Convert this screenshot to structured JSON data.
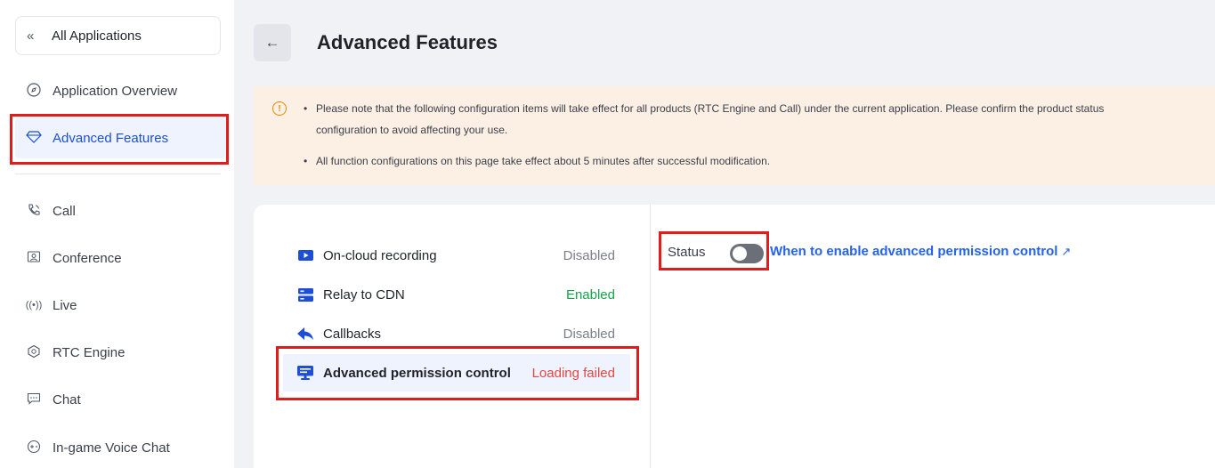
{
  "sidebar": {
    "all_apps": "All Applications",
    "items": [
      {
        "label": "Application Overview",
        "icon": "compass-icon"
      },
      {
        "label": "Advanced Features",
        "icon": "diamond-icon"
      },
      {
        "label": "Call",
        "icon": "phone-icon"
      },
      {
        "label": "Conference",
        "icon": "conference-icon"
      },
      {
        "label": "Live",
        "icon": "broadcast-icon"
      },
      {
        "label": "RTC Engine",
        "icon": "engine-icon"
      },
      {
        "label": "Chat",
        "icon": "chat-icon"
      },
      {
        "label": "In-game Voice Chat",
        "icon": "gamepad-icon"
      }
    ]
  },
  "header": {
    "title": "Advanced Features"
  },
  "notice": {
    "line1": "Please note that the following configuration items will take effect for all products (RTC Engine and Call) under the current application. Please confirm the product status",
    "line2": "configuration to avoid affecting your use.",
    "line3": "All function configurations on this page take effect about 5 minutes after successful modification."
  },
  "features": [
    {
      "label": "On-cloud recording",
      "status": "Disabled",
      "status_type": "disabled",
      "icon": "video-icon"
    },
    {
      "label": "Relay to CDN",
      "status": "Enabled",
      "status_type": "enabled",
      "icon": "server-icon"
    },
    {
      "label": "Callbacks",
      "status": "Disabled",
      "status_type": "disabled",
      "icon": "reply-icon"
    },
    {
      "label": "Advanced permission control",
      "status": "Loading failed",
      "status_type": "failed",
      "icon": "monitor-icon"
    }
  ],
  "detail": {
    "status_label": "Status",
    "toggle_on": false,
    "help_link": "When to enable advanced permission control"
  },
  "colors": {
    "accent": "#1d4ed8",
    "link": "#2563eb",
    "enabled": "#16a34a",
    "failed": "#e54545",
    "highlight_box": "#e21b1b",
    "notice_bg": "#fcefe3"
  }
}
